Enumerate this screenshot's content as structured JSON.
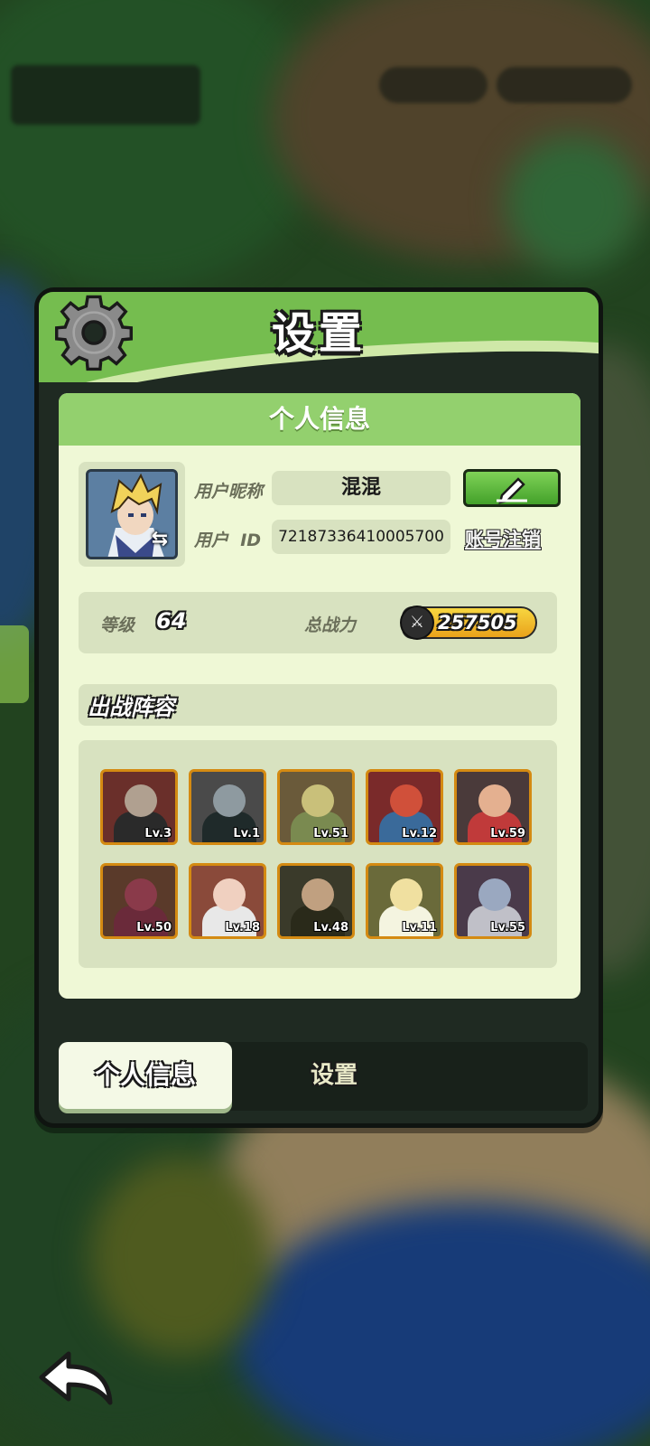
{
  "header": {
    "title": "设置"
  },
  "section": {
    "title": "个人信息"
  },
  "profile": {
    "nickname_label": "用户昵称",
    "nickname": "混混",
    "id_label": "用户  ID",
    "user_id": "72187336410005700",
    "cancel_account": "账号注销"
  },
  "stats": {
    "level_label": "等级",
    "level": "64",
    "power_label": "总战力",
    "power": "257505"
  },
  "lineup": {
    "title": "出战阵容",
    "heroes": [
      {
        "level": "Lv.3",
        "color": "#6a2f2a",
        "face": "#b0a090",
        "body": "#2a2a2a"
      },
      {
        "level": "Lv.1",
        "color": "#4a4a4a",
        "face": "#8e9aa0",
        "body": "#1f2a2a"
      },
      {
        "level": "Lv.51",
        "color": "#6a5a3a",
        "face": "#c9c07a",
        "body": "#7a8a50"
      },
      {
        "level": "Lv.12",
        "color": "#7a2a2a",
        "face": "#d0503a",
        "body": "#3a6a9a"
      },
      {
        "level": "Lv.59",
        "color": "#4a3a3a",
        "face": "#e4b090",
        "body": "#c03a3a"
      },
      {
        "level": "Lv.50",
        "color": "#5a3a2a",
        "face": "#8a3a4a",
        "body": "#6a2a3a"
      },
      {
        "level": "Lv.18",
        "color": "#8a4a3a",
        "face": "#f0d0c0",
        "body": "#e8e8e8"
      },
      {
        "level": "Lv.48",
        "color": "#3a3a2a",
        "face": "#c0a080",
        "body": "#2a2a1a"
      },
      {
        "level": "Lv.11",
        "color": "#6a6a3a",
        "face": "#f0e0a0",
        "body": "#f4f4e0"
      },
      {
        "level": "Lv.55",
        "color": "#4a3a4a",
        "face": "#9aa8c0",
        "body": "#c0c0c8"
      }
    ]
  },
  "tabs": {
    "active": "个人信息",
    "other": "设置"
  },
  "colors": {
    "accent_green": "#75bd4f",
    "panel_bg": "#eff8d6",
    "power_gold": "#e9a21b"
  }
}
